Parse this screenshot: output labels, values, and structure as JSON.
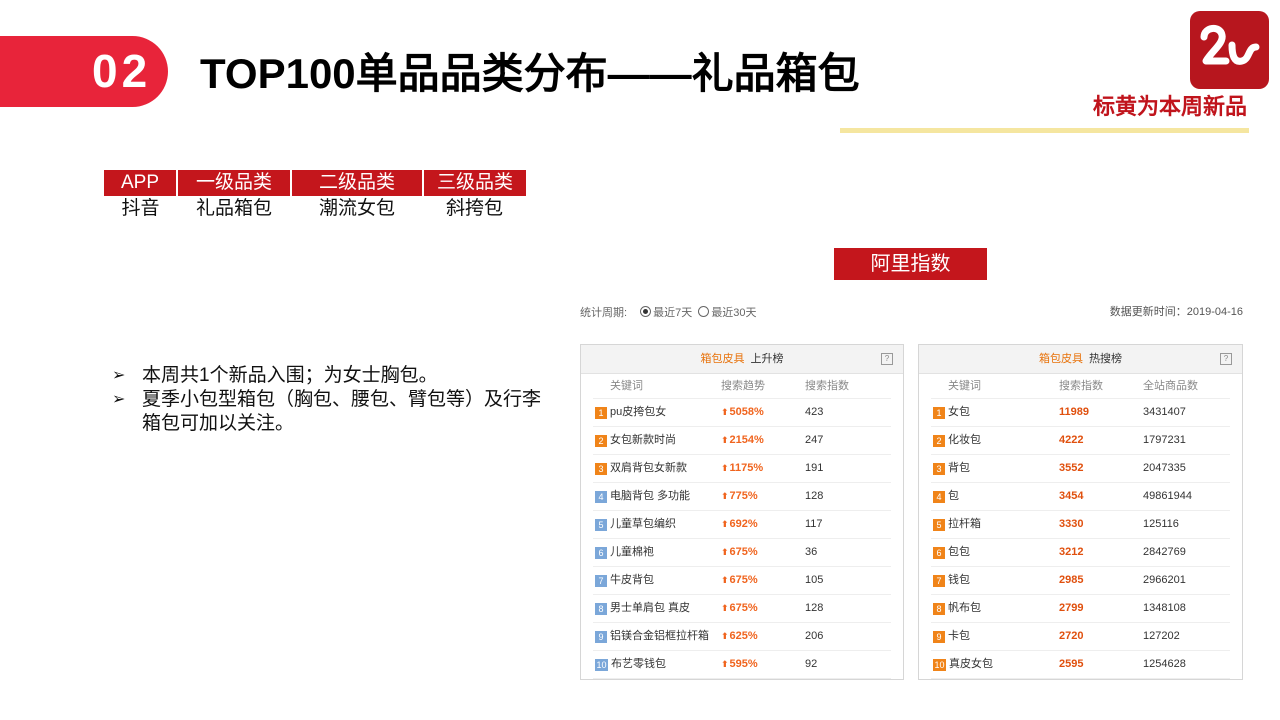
{
  "header": {
    "badge": "02",
    "title": "TOP100单品品类分布——礼品箱包",
    "note": "标黄为本周新品"
  },
  "category_table": {
    "headers": [
      "APP",
      "一级品类",
      "二级品类",
      "三级品类"
    ],
    "values": [
      "抖音",
      "礼品箱包",
      "潮流女包",
      "斜挎包"
    ]
  },
  "ali_label": "阿里指数",
  "bullets": [
    "本周共1个新品入围；为女士胸包。",
    "夏季小包型箱包（胸包、腰包、臂包等）及行李箱包可加以关注。"
  ],
  "bullet_icon": "arrow-bullet-icon",
  "stats": {
    "period_label": "统计周期:",
    "option_7": "最近7天",
    "option_30": "最近30天",
    "selected": "最近7天",
    "update_label": "数据更新时间：2019-04-16"
  },
  "rising_panel": {
    "category": "箱包皮具",
    "title": "上升榜",
    "help": "?",
    "columns": [
      "关键词",
      "搜索趋势",
      "搜索指数"
    ],
    "rows": [
      {
        "rank": "1",
        "keyword": "pu皮挎包女",
        "trend": "5058%",
        "index": "423"
      },
      {
        "rank": "2",
        "keyword": "女包新款时尚",
        "trend": "2154%",
        "index": "247"
      },
      {
        "rank": "3",
        "keyword": "双肩背包女新款",
        "trend": "1175%",
        "index": "191"
      },
      {
        "rank": "4",
        "keyword": "电脑背包 多功能",
        "trend": "775%",
        "index": "128"
      },
      {
        "rank": "5",
        "keyword": "儿童草包编织",
        "trend": "692%",
        "index": "117"
      },
      {
        "rank": "6",
        "keyword": "儿童棉袍",
        "trend": "675%",
        "index": "36"
      },
      {
        "rank": "7",
        "keyword": "牛皮背包",
        "trend": "675%",
        "index": "105"
      },
      {
        "rank": "8",
        "keyword": "男士单肩包 真皮",
        "trend": "675%",
        "index": "128"
      },
      {
        "rank": "9",
        "keyword": "铝镁合金铝框拉杆箱",
        "trend": "625%",
        "index": "206"
      },
      {
        "rank": "10",
        "keyword": "布艺零钱包",
        "trend": "595%",
        "index": "92"
      }
    ]
  },
  "hot_panel": {
    "category": "箱包皮具",
    "title": "热搜榜",
    "help": "?",
    "columns": [
      "关键词",
      "搜索指数",
      "全站商品数"
    ],
    "rows": [
      {
        "rank": "1",
        "keyword": "女包",
        "index": "11989",
        "count": "3431407"
      },
      {
        "rank": "2",
        "keyword": "化妆包",
        "index": "4222",
        "count": "1797231"
      },
      {
        "rank": "3",
        "keyword": "背包",
        "index": "3552",
        "count": "2047335"
      },
      {
        "rank": "4",
        "keyword": "包",
        "index": "3454",
        "count": "49861944"
      },
      {
        "rank": "5",
        "keyword": "拉杆箱",
        "index": "3330",
        "count": "125116"
      },
      {
        "rank": "6",
        "keyword": "包包",
        "index": "3212",
        "count": "2842769"
      },
      {
        "rank": "7",
        "keyword": "钱包",
        "index": "2985",
        "count": "2966201"
      },
      {
        "rank": "8",
        "keyword": "帆布包",
        "index": "2799",
        "count": "1348108"
      },
      {
        "rank": "9",
        "keyword": "卡包",
        "index": "2720",
        "count": "127202"
      },
      {
        "rank": "10",
        "keyword": "真皮女包",
        "index": "2595",
        "count": "1254628"
      }
    ]
  },
  "colors": {
    "accent_red": "#e8243a",
    "table_red": "#c4161c",
    "logo_red": "#b7161e",
    "highlight_yellow": "#f5e6a0",
    "rank_hot": "#f08419",
    "rank_cool": "#7ba7d9",
    "trend_orange": "#f0641e"
  }
}
